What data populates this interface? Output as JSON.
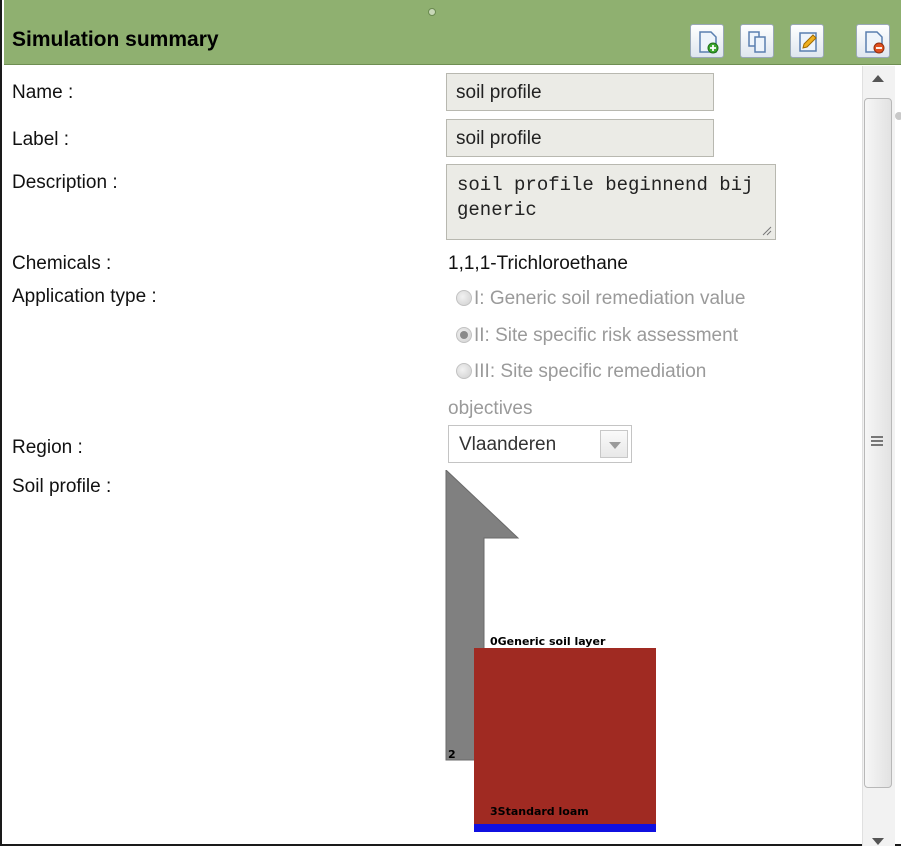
{
  "header": {
    "title": "Simulation summary"
  },
  "toolbar": {
    "buttons": [
      {
        "icon": "add-document-icon"
      },
      {
        "icon": "copy-document-icon"
      },
      {
        "icon": "edit-document-icon"
      },
      {
        "icon": "delete-document-icon"
      }
    ]
  },
  "form": {
    "name_label": "Name :",
    "name_value": "soil profile",
    "label_label": "Label :",
    "label_value": "soil profile",
    "description_label": "Description :",
    "description_value": "soil profile beginnend bij generic",
    "chemicals_label": "Chemicals :",
    "chemicals_value": "1,1,1-Trichloroethane",
    "application_type_label": "Application type :",
    "application_options": [
      {
        "label": "I: Generic soil remediation value",
        "checked": false
      },
      {
        "label": "II: Site specific risk assessment",
        "checked": true
      },
      {
        "label": "III: Site specific remediation",
        "checked": false
      }
    ],
    "application_option_3_continuation": "objectives",
    "region_label": "Region :",
    "region_value": "Vlaanderen",
    "soil_profile_label": "Soil profile :"
  },
  "soil_profile": {
    "top_layer_label": "0Generic soil layer",
    "groundwater_depth_label": "2",
    "bottom_layer_label": "3Standard loam",
    "colors": {
      "arrow": "#808080",
      "soil": "#a02a22",
      "water": "#1010e0"
    }
  },
  "colors": {
    "header_bg": "#8fb070",
    "field_bg": "#ebebe6"
  }
}
